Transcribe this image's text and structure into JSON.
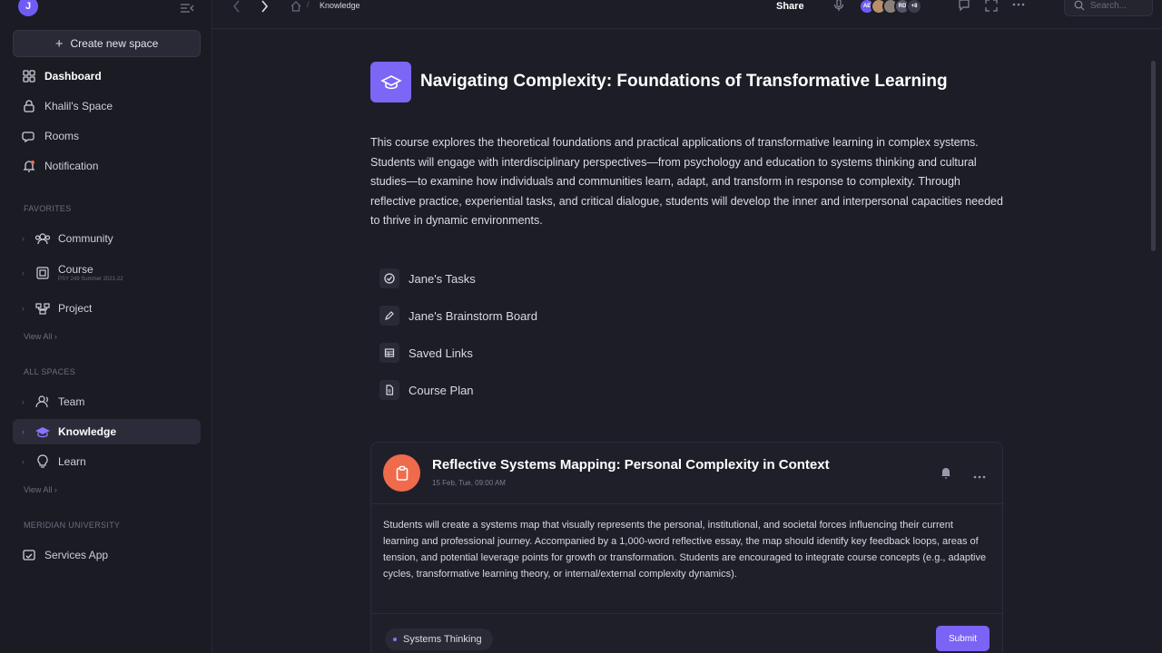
{
  "sidebar": {
    "logo_letter": "J",
    "create_label": "Create new space",
    "nav": [
      {
        "label": "Dashboard",
        "icon": "grid-icon"
      },
      {
        "label": "Khalil's Space",
        "icon": "lock-icon"
      },
      {
        "label": "Rooms",
        "icon": "chat-icon"
      },
      {
        "label": "Notification",
        "icon": "bell-icon"
      }
    ],
    "favorites_label": "FAVORITES",
    "favorites": [
      {
        "label": "Community",
        "icon": "community-icon"
      },
      {
        "label": "Course",
        "sub": "PSY 249 Summer 2021-22",
        "icon": "course-icon"
      },
      {
        "label": "Project",
        "icon": "project-icon"
      }
    ],
    "view_all_1": "View All",
    "spaces_label": "All SPACES",
    "spaces": [
      {
        "label": "Team",
        "icon": "team-icon"
      },
      {
        "label": "Knowledge",
        "icon": "graduation-cap-icon"
      },
      {
        "label": "Learn",
        "icon": "bulb-icon"
      }
    ],
    "view_all_2": "View All",
    "org_label": "MERIDIAN UNIVERSITY",
    "org_items": [
      {
        "label": "Services App",
        "icon": "app-window-icon"
      }
    ]
  },
  "topbar": {
    "breadcrumb_current": "Knowledge",
    "share_label": "Share",
    "avatars": [
      {
        "text": "AE",
        "color": "#6f5cf6"
      },
      {
        "text": "",
        "color": "#b98f6a"
      },
      {
        "text": "",
        "color": "#8a8078"
      },
      {
        "text": "RD",
        "color": "#55556a"
      },
      {
        "text": "+8",
        "color": "#3b3b4b"
      }
    ],
    "search_placeholder": "Search..."
  },
  "page": {
    "title": "Navigating Complexity: Foundations of Transformative Learning",
    "description": "This course explores the theoretical foundations and practical applications of transformative learning in complex systems. Students will engage with interdisciplinary perspectives—from psychology and education to systems thinking and cultural studies—to examine how individuals and communities learn, adapt, and transform in response to complexity. Through reflective practice, experiential tasks, and critical dialogue, students will develop the inner and interpersonal capacities needed to thrive in dynamic environments.",
    "links": [
      {
        "label": "Jane's Tasks",
        "icon": "tasks-icon"
      },
      {
        "label": "Jane's Brainstorm Board",
        "icon": "pen-icon"
      },
      {
        "label": "Saved Links",
        "icon": "table-icon"
      },
      {
        "label": "Course Plan",
        "icon": "document-icon"
      }
    ]
  },
  "card": {
    "title": "Reflective Systems Mapping: Personal Complexity in Context",
    "date": "15 Feb, Tue, 09:00 AM",
    "body": "Students will create a systems map that visually represents the personal, institutional, and societal forces influencing their current learning and professional journey. Accompanied by a 1,000-word reflective essay, the map should identify key feedback loops, areas of tension, and potential leverage points for growth or transformation. Students are encouraged to integrate course concepts (e.g., adaptive cycles, transformative learning theory, or internal/external complexity dynamics).",
    "tag": "Systems Thinking",
    "submit_label": "Submit"
  }
}
